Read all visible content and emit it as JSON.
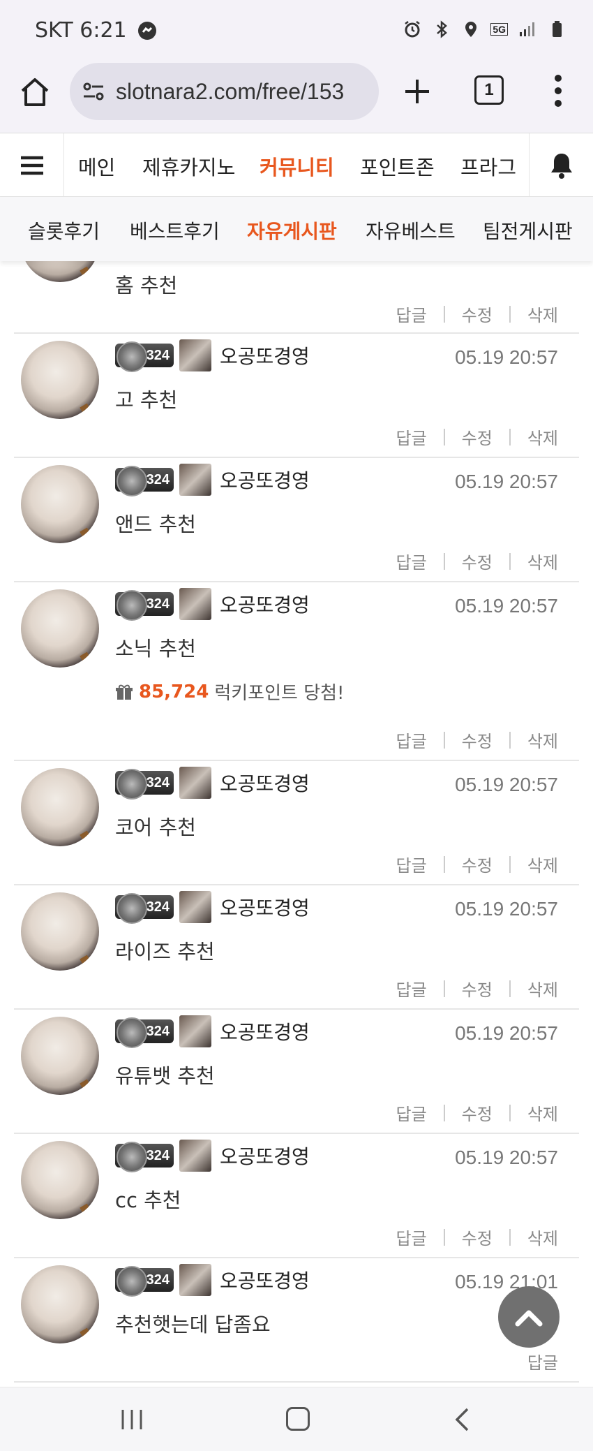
{
  "status_bar": {
    "carrier_time": "SKT 6:21",
    "network": "5G"
  },
  "browser": {
    "url": "slotnara2.com/free/153",
    "tab_count": "1"
  },
  "site_nav": {
    "items": [
      "메인",
      "제휴카지노",
      "커뮤니티",
      "포인트존",
      "프라그"
    ],
    "active_index": 2
  },
  "sub_nav": {
    "items": [
      "슬롯후기",
      "베스트후기",
      "자유게시판",
      "자유베스트",
      "팀전게시판"
    ],
    "active_index": 2
  },
  "comments": [
    {
      "level": "",
      "nickname": "",
      "timestamp": "",
      "content": "홈 추천",
      "actions": [
        "답글",
        "수정",
        "삭제"
      ]
    },
    {
      "level": "324",
      "nickname": "오공또경영",
      "timestamp": "05.19 20:57",
      "content": "고 추천",
      "actions": [
        "답글",
        "수정",
        "삭제"
      ]
    },
    {
      "level": "324",
      "nickname": "오공또경영",
      "timestamp": "05.19 20:57",
      "content": "앤드 추천",
      "actions": [
        "답글",
        "수정",
        "삭제"
      ]
    },
    {
      "level": "324",
      "nickname": "오공또경영",
      "timestamp": "05.19 20:57",
      "content": "소닉 추천",
      "lucky_amount": "85,724",
      "lucky_text": "럭키포인트 당첨!",
      "actions": [
        "답글",
        "수정",
        "삭제"
      ]
    },
    {
      "level": "324",
      "nickname": "오공또경영",
      "timestamp": "05.19 20:57",
      "content": "코어 추천",
      "actions": [
        "답글",
        "수정",
        "삭제"
      ]
    },
    {
      "level": "324",
      "nickname": "오공또경영",
      "timestamp": "05.19 20:57",
      "content": "라이즈 추천",
      "actions": [
        "답글",
        "수정",
        "삭제"
      ]
    },
    {
      "level": "324",
      "nickname": "오공또경영",
      "timestamp": "05.19 20:57",
      "content": "유튜뱃 추천",
      "actions": [
        "답글",
        "수정",
        "삭제"
      ]
    },
    {
      "level": "324",
      "nickname": "오공또경영",
      "timestamp": "05.19 20:57",
      "content": "cc 추천",
      "actions": [
        "답글",
        "수정",
        "삭제"
      ]
    },
    {
      "level": "324",
      "nickname": "오공또경영",
      "timestamp": "05.19 21:01",
      "content": "추천햇는데 답좀요",
      "actions": [
        "답글"
      ]
    }
  ],
  "colors": {
    "accent": "#e8571e",
    "chrome_bg": "#f4f2f8",
    "url_bg": "#e2e0ea"
  }
}
